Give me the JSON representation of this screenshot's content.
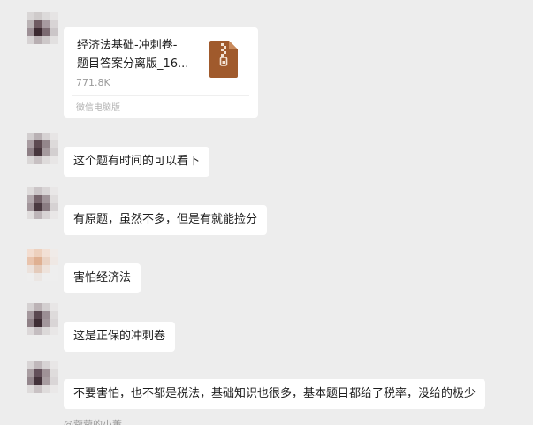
{
  "file_message": {
    "name_line1": "经济法基础-冲刺卷-",
    "name_line2": "题目答案分离版_16...",
    "size": "771.8K",
    "source": "微信电脑版",
    "icon": "zip-file-icon"
  },
  "messages": [
    {
      "text": "这个题有时间的可以看下"
    },
    {
      "text": "有原题，虽然不多，但是有就能捡分"
    },
    {
      "text": "害怕经济法"
    },
    {
      "text": "这是正保的冲刺卷"
    },
    {
      "text": "不要害怕，也不都是税法，基础知识也很多，基本题目都给了税率，没给的极少"
    }
  ],
  "partial_sender": "@菀菀的小董",
  "colors": {
    "chat_bg": "#ededed",
    "bubble_bg": "#ffffff",
    "zip_icon": "#a05a2c"
  }
}
